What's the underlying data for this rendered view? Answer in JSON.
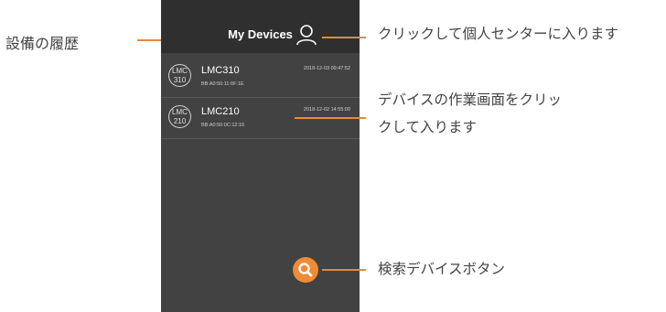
{
  "header": {
    "title": "My Devices",
    "user_icon": "user-icon"
  },
  "devices": [
    {
      "badge_line1": "LMC",
      "badge_line2": "310",
      "name": "LMC310",
      "mac": "BB:A0:50:11:0F:1E",
      "timestamp": "2018-12-03 09:47:52"
    },
    {
      "badge_line1": "LMC",
      "badge_line2": "210",
      "name": "LMC210",
      "mac": "BB:A0:50:0C:12:16",
      "timestamp": "2018-12-02 14:55:00"
    }
  ],
  "search_button": {
    "icon": "search-icon",
    "color": "#f08a36"
  },
  "annotations": {
    "history": "設備の履歴",
    "user_center": "クリックして個人センターに入ります",
    "device_page_line1": "デバイスの作業画面をクリッ",
    "device_page_line2": "クして入ります",
    "search": "検索デバイスボタン",
    "line_color": "#e58a3a"
  },
  "theme": {
    "panel_bg": "#424242",
    "header_bg": "#2f2f2f"
  }
}
